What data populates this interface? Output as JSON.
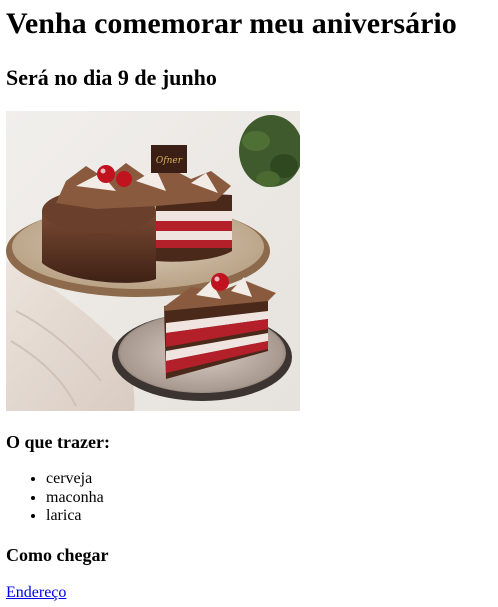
{
  "header": {
    "title": "Venha comemorar meu aniversário",
    "subtitle": "Será no dia 9 de junho"
  },
  "image": {
    "logo_text": "Ofner"
  },
  "bring": {
    "heading": "O que trazer:",
    "items": [
      "cerveja",
      "maconha",
      "larica"
    ]
  },
  "directions": {
    "heading": "Como chegar",
    "link_label": "Endereço"
  },
  "colors": {
    "link": "#0000ee",
    "text": "#000000",
    "background": "#ffffff"
  }
}
